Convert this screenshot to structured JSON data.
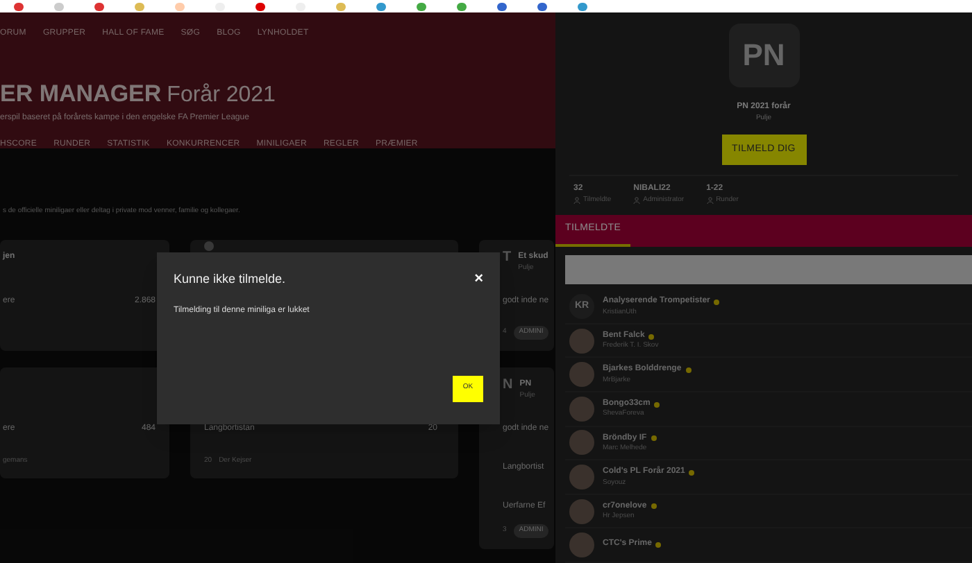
{
  "top_nav": [
    "ORUM",
    "GRUPPER",
    "HALL OF FAME",
    "SØG",
    "BLOG",
    "LYNHOLDET"
  ],
  "hero": {
    "title": "ER MANAGER",
    "title_suffix": "Forår 2021",
    "subtitle": "erspil baseret på forårets kampe i den engelske FA Premier League"
  },
  "sub_nav": [
    "HSCORE",
    "RUNDER",
    "STATISTIK",
    "KONKURRENCER",
    "MINILIGAER",
    "REGLER",
    "PRÆMIER"
  ],
  "intro": "s de officielle miniligaer eller deltag i private mod venner, familie og kollegaer.",
  "cards": [
    {
      "title": "jen",
      "line": "ere",
      "count": "2.868"
    },
    {
      "icon": true
    },
    {
      "badge": "T",
      "title": "Et skud",
      "type": "Pulje",
      "line": "godt inde ne",
      "stat": "4",
      "chip": "ADMINI"
    },
    {
      "line": "ere",
      "count": "484",
      "footer": "gemans"
    },
    {
      "line": "Langbortistan",
      "count": "20",
      "stat": "20",
      "footer": "Der Kejser"
    },
    {
      "badge": "N",
      "title": "PN",
      "type": "Pulje",
      "line": "godt inde ne",
      "line2": "Langbortist",
      "line3": "Uerfarne Ef",
      "stat": "3",
      "chip": "ADMINI"
    }
  ],
  "panel": {
    "initials": "PN",
    "name": "PN 2021 forår",
    "type": "Pulje",
    "join_button": "TILMELD DIG",
    "stats": [
      {
        "value": "32",
        "label": "Tilmeldte"
      },
      {
        "value": "NIBALI22",
        "label": "Administrator"
      },
      {
        "value": "1-22",
        "label": "Runder"
      }
    ],
    "tabs": [
      {
        "label": "TILMELDTE",
        "selected": true
      }
    ],
    "members": [
      {
        "kind": "initials",
        "initials": "KR",
        "name": "Analyserende Trompetister",
        "manager": "KristianUth",
        "online": true
      },
      {
        "kind": "photo",
        "name": "Bent Falck",
        "manager": "Frederik T. I. Skov",
        "online": true
      },
      {
        "kind": "photo",
        "name": "Bjarkes Bolddrenge",
        "manager": "MrBjarke",
        "online": true
      },
      {
        "kind": "photo",
        "name": "Bongo33cm",
        "manager": "ShevaForeva",
        "online": true
      },
      {
        "kind": "photo",
        "name": "Bröndby IF",
        "manager": "Marc Melhede",
        "online": true
      },
      {
        "kind": "photo",
        "name": "Cold's PL Forår 2021",
        "manager": "Soyouz",
        "online": true
      },
      {
        "kind": "photo",
        "name": "cr7onelove",
        "manager": "Hr Jepsen",
        "online": true
      },
      {
        "kind": "photo",
        "name": "CTC's Prime",
        "online": true
      }
    ]
  },
  "dialog": {
    "title": "Kunne ikke tilmelde.",
    "close": "×",
    "message": "Tilmelding til denne miniliga er lukket",
    "button": "OK"
  }
}
